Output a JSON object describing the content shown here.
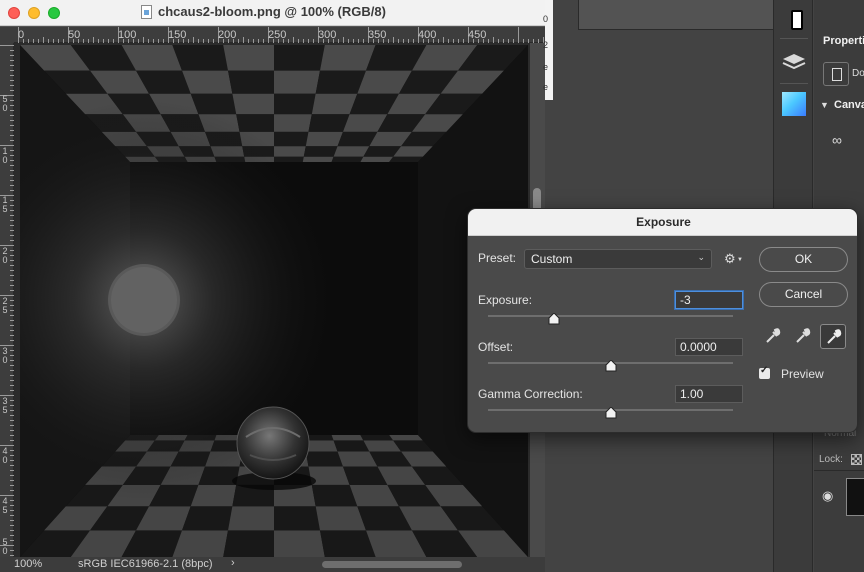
{
  "document": {
    "title": "chcaus2-bloom.png @ 100% (RGB/8)",
    "ruler_h_labels": [
      "0",
      "50",
      "100",
      "150",
      "200",
      "250",
      "300",
      "350",
      "400",
      "450"
    ],
    "ruler_v_labels": [
      "5",
      "0",
      "1",
      "0",
      "1",
      "5",
      "2",
      "0",
      "2",
      "5",
      "3",
      "0",
      "3",
      "5",
      "4",
      "0",
      "4",
      "5",
      "5",
      "0"
    ],
    "status": {
      "zoom": "100%",
      "profile": "sRGB IEC61966-2.1 (8bpc)",
      "arrow": "›"
    }
  },
  "background": {
    "fragments": [
      "0",
      "2",
      "e",
      "e"
    ],
    "properties": {
      "title": "Properti",
      "doc_label": "Do",
      "canvas_label": "Canva",
      "blend_mode": "Normal",
      "lock_label": "Lock:"
    }
  },
  "exposure_dialog": {
    "title": "Exposure",
    "preset_label": "Preset:",
    "preset_value": "Custom",
    "fields": [
      {
        "label": "Exposure:",
        "value": "-3"
      },
      {
        "label": "Offset:",
        "value": "0.0000"
      },
      {
        "label": "Gamma Correction:",
        "value": "1.00"
      }
    ],
    "sliders": {
      "exposure_fraction": 0.27,
      "offset_fraction": 0.5,
      "gamma_fraction": 0.5
    },
    "ok_label": "OK",
    "cancel_label": "Cancel",
    "preview_label": "Preview",
    "preview_checked": true
  },
  "colors": {
    "accent": "#4d8fde",
    "panel": "#4a4a4a",
    "dark": "#2b2b2b"
  }
}
